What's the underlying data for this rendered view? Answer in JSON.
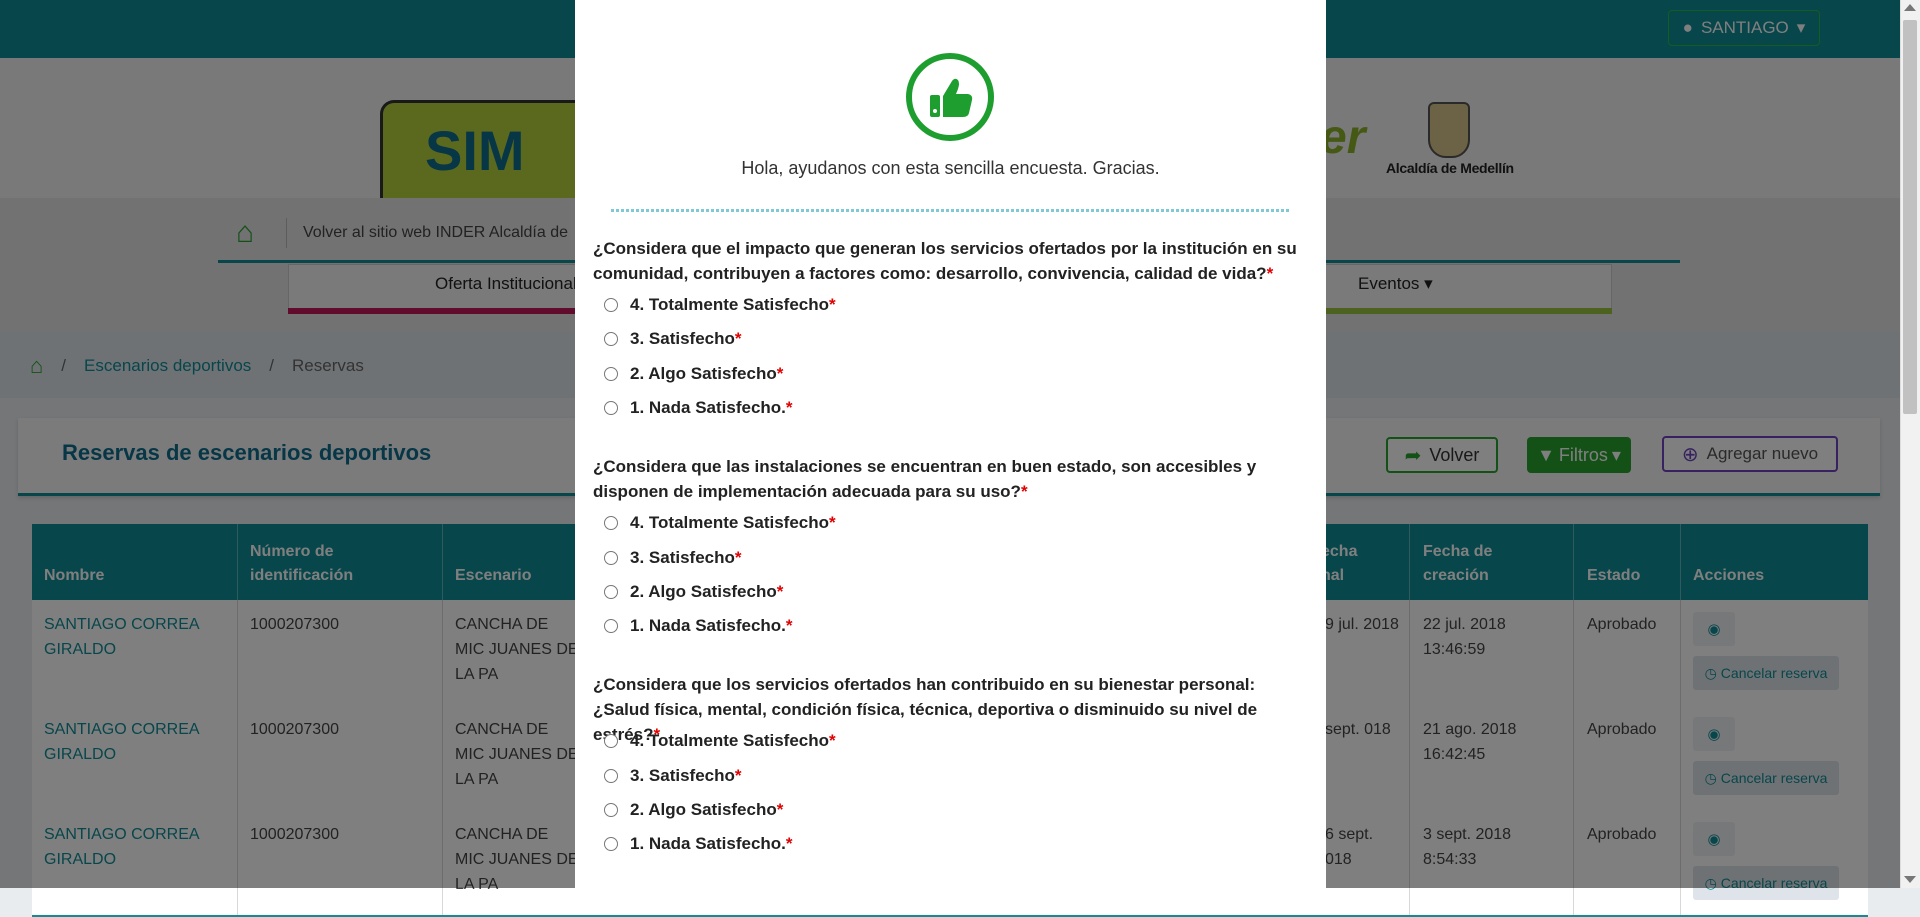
{
  "header": {
    "user_label": "SANTIAGO"
  },
  "banner": {
    "logo_text": "SIM",
    "partner_text": "er",
    "alcaldia": "Alcaldía de Medellín"
  },
  "nav": {
    "back_site": "Volver al sitio web INDER Alcaldía de",
    "menu_1": "Oferta Institucional",
    "menu_2": "Eventos"
  },
  "breadcrumb": {
    "item_1": "Escenarios deportivos",
    "item_2": "Reservas",
    "sep": "/"
  },
  "panel": {
    "title": "Reservas de escenarios deportivos",
    "volver": "Volver",
    "filtros": "Filtros",
    "agregar": "Agregar nuevo"
  },
  "table": {
    "headers": [
      "Nombre",
      "Número de identificación",
      "Escenario",
      "echa\nnal",
      "Fecha de creación",
      "Estado",
      "Acciones"
    ],
    "cancel_label": "Cancelar reserva",
    "rows": [
      {
        "nombre": "SANTIAGO CORREA GIRALDO",
        "id": "1000207300",
        "escenario": "CANCHA DE MIC JUANES DE LA PA",
        "fecha_final": "9 jul. 2018",
        "creacion": "22 jul. 2018 13:46:59",
        "estado": "Aprobado"
      },
      {
        "nombre": "SANTIAGO CORREA GIRALDO",
        "id": "1000207300",
        "escenario": "CANCHA DE MIC JUANES DE LA PA",
        "fecha_final": " sept. 018",
        "creacion": "21 ago. 2018 16:42:45",
        "estado": "Aprobado"
      },
      {
        "nombre": "SANTIAGO CORREA GIRALDO",
        "id": "1000207300",
        "escenario": "CANCHA DE MIC JUANES DE LA PA",
        "fecha_final": "6 sept. 018",
        "creacion": "3 sept. 2018 8:54:33",
        "estado": "Aprobado"
      }
    ]
  },
  "survey": {
    "intro": "Hola, ayudanos con esta sencilla encuesta. Gracias.",
    "required_mark": "*",
    "questions": [
      {
        "text": "¿Considera que el impacto que generan los servicios ofertados por la institución en su comunidad, contribuyen a factores como: desarrollo, convivencia, calidad de vida?",
        "options": [
          "4. Totalmente Satisfecho",
          "3. Satisfecho",
          "2. Algo Satisfecho",
          "1. Nada Satisfecho."
        ]
      },
      {
        "text": "¿Considera que las instalaciones se encuentran en buen estado, son accesibles y disponen de implementación adecuada para su uso?",
        "options": [
          "4. Totalmente Satisfecho",
          "3. Satisfecho",
          "2. Algo Satisfecho",
          "1. Nada Satisfecho."
        ]
      },
      {
        "text": "¿Considera que los servicios ofertados han contribuido en su bienestar personal: ¿Salud física, mental, condición física, técnica, deportiva o disminuido su nivel de estrés?",
        "options": [
          "4. Totalmente Satisfecho",
          "3. Satisfecho",
          "2. Algo Satisfecho",
          "1. Nada Satisfecho."
        ]
      }
    ]
  },
  "colors": {
    "primary": "#0f8d96",
    "success": "#27a32f",
    "required": "#e00000"
  },
  "icons": [
    "user-icon",
    "home-icon",
    "thumbs-up-icon",
    "arrow-circle-left-icon",
    "filter-icon",
    "plus-circle-icon",
    "eye-icon",
    "clock-icon"
  ]
}
